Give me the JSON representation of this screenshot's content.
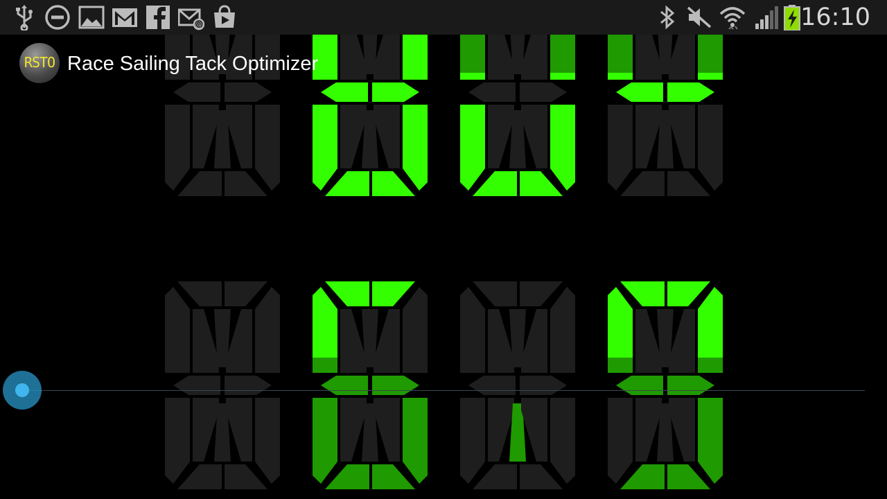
{
  "status_bar": {
    "time": "16:10",
    "left_icons": [
      "usb-icon",
      "do-not-disturb-icon",
      "gallery-icon",
      "gmail-icon",
      "facebook-icon",
      "email-icon",
      "play-store-icon"
    ],
    "right_icons": [
      "bluetooth-icon",
      "muted-icon",
      "wifi-icon",
      "signal-icon",
      "battery-charging-icon"
    ]
  },
  "action_bar": {
    "app_icon_text": "RSTO",
    "title": "Race Sailing Tack Optimizer"
  },
  "display": {
    "lit_color": "#33ff00",
    "dim_color": "#1f9a00",
    "off_color": "#1e1e1e",
    "background": "#000000"
  },
  "scrubber": {
    "position": 0
  }
}
